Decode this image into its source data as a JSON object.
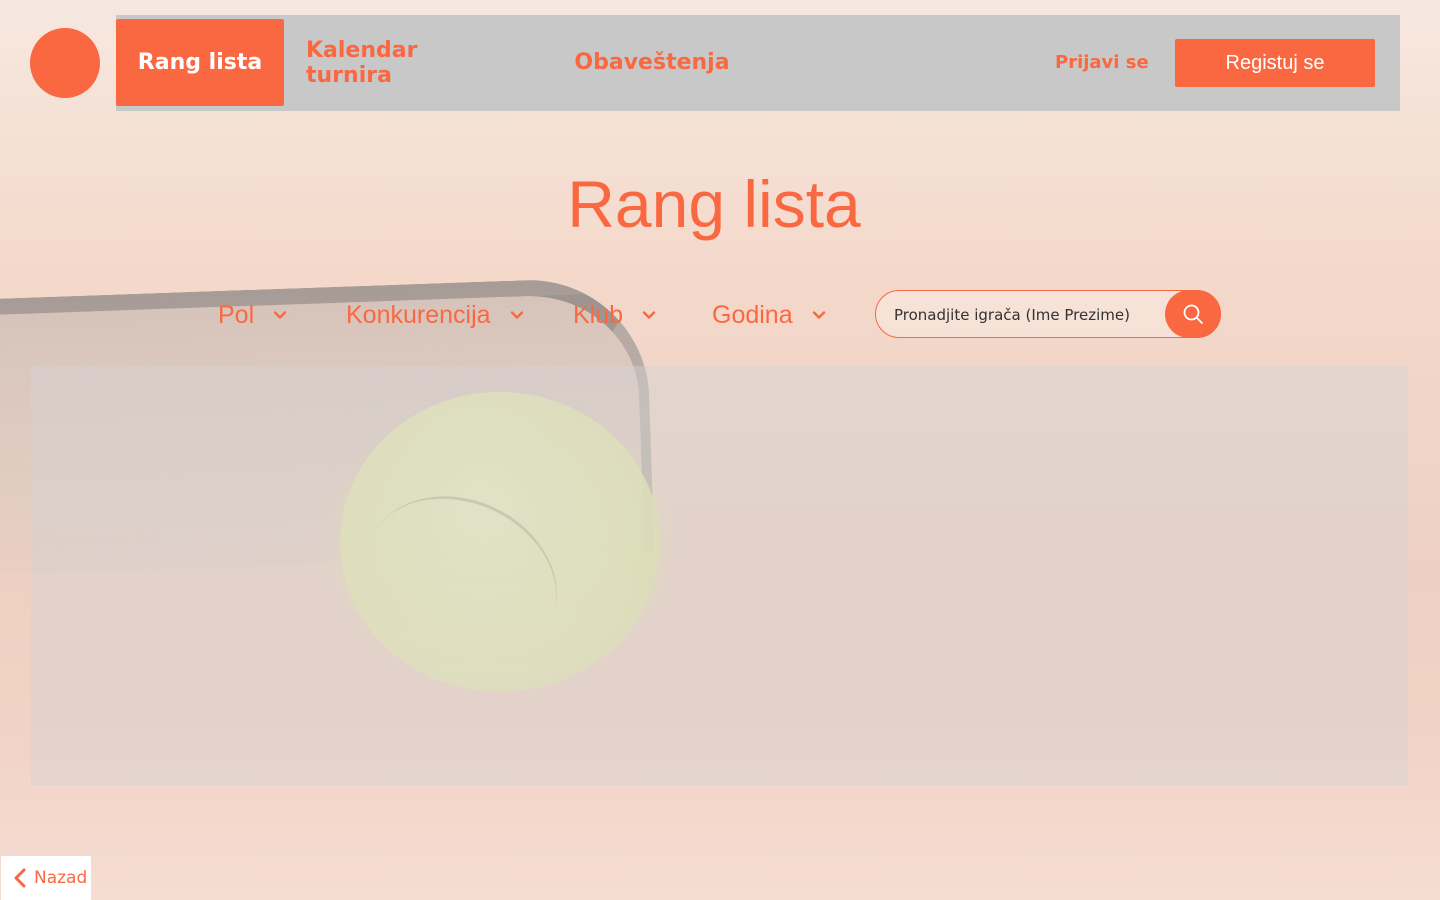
{
  "nav": {
    "items": [
      {
        "label": "Rang lista",
        "active": true
      },
      {
        "label": "Kalendar turnira",
        "active": false
      },
      {
        "label": "Obaveštenja",
        "active": false
      }
    ],
    "login_label": "Prijavi se",
    "register_label": "Registuj se"
  },
  "page": {
    "title": "Rang lista"
  },
  "filters": [
    {
      "label": "Pol",
      "icon": "chevron-down-icon"
    },
    {
      "label": "Konkurencija",
      "icon": "chevron-down-icon"
    },
    {
      "label": "Klub",
      "icon": "chevron-down-icon"
    },
    {
      "label": "Godina",
      "icon": "chevron-down-icon"
    }
  ],
  "search": {
    "placeholder": "Pronadjite igrača (Ime Prezime)",
    "icon": "search-icon"
  },
  "footer": {
    "back_label": "Nazad",
    "back_icon": "chevron-left-icon"
  },
  "colors": {
    "accent": "#fa6841",
    "nav_background": "#c8c8c8",
    "text_on_accent": "#ffffff"
  }
}
